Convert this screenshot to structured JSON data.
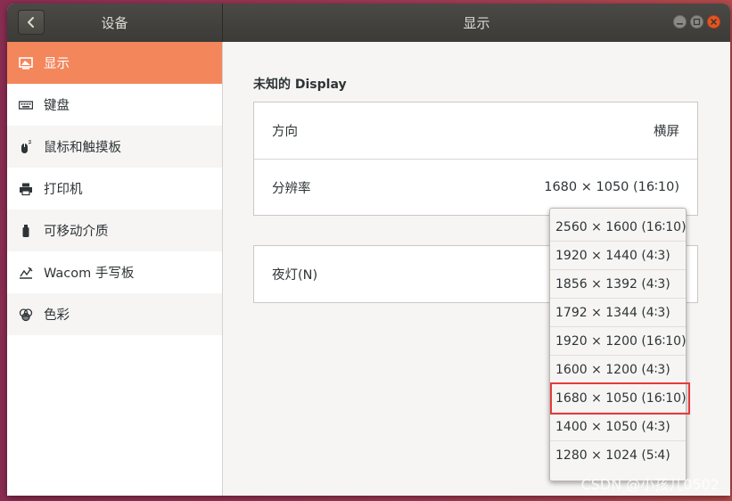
{
  "titlebar": {
    "left_title": "设备",
    "main_title": "显示"
  },
  "sidebar": {
    "items": [
      {
        "label": "显示",
        "icon": "display-icon",
        "active": true
      },
      {
        "label": "键盘",
        "icon": "keyboard-icon"
      },
      {
        "label": "鼠标和触摸板",
        "icon": "mouse-icon"
      },
      {
        "label": "打印机",
        "icon": "printer-icon"
      },
      {
        "label": "可移动介质",
        "icon": "removable-media-icon"
      },
      {
        "label": "Wacom 手写板",
        "icon": "tablet-icon"
      },
      {
        "label": "色彩",
        "icon": "color-icon"
      }
    ]
  },
  "display": {
    "section_title": "未知的 Display",
    "orientation_label": "方向",
    "orientation_value": "横屏",
    "resolution_label": "分辨率",
    "resolution_value": "1680 × 1050 (16∶10)",
    "night_light_label": "夜灯(N)"
  },
  "resolution_options": [
    "2560 × 1600 (16∶10)",
    "1920 × 1440 (4∶3)",
    "1856 × 1392 (4∶3)",
    "1792 × 1344 (4∶3)",
    "1920 × 1200 (16∶10)",
    "1600 × 1200 (4∶3)",
    "1680 × 1050 (16∶10)",
    "1400 × 1050 (4∶3)",
    "1280 × 1024 (5∶4)"
  ],
  "selected_option_index": 6,
  "watermark": "CSDN @小孩儿0502",
  "colors": {
    "accent": "#f4865c",
    "titlebar": "#3c3b37",
    "close": "#e95420",
    "highlight": "#e63a3a"
  }
}
